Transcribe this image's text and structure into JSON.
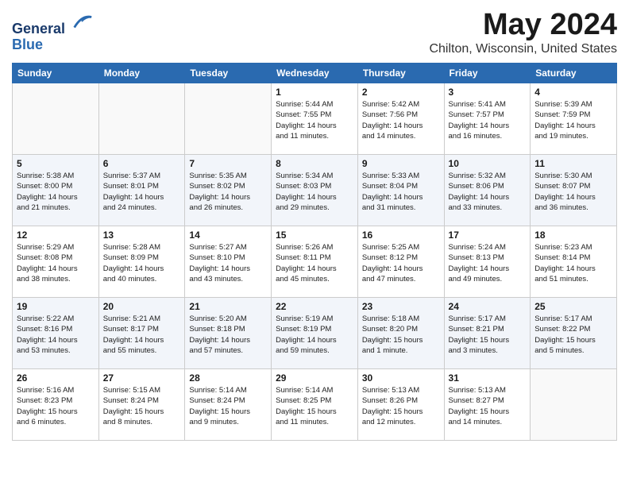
{
  "header": {
    "logo_line1": "General",
    "logo_line2": "Blue",
    "month_title": "May 2024",
    "location": "Chilton, Wisconsin, United States"
  },
  "days_of_week": [
    "Sunday",
    "Monday",
    "Tuesday",
    "Wednesday",
    "Thursday",
    "Friday",
    "Saturday"
  ],
  "weeks": [
    [
      {
        "day": "",
        "detail": ""
      },
      {
        "day": "",
        "detail": ""
      },
      {
        "day": "",
        "detail": ""
      },
      {
        "day": "1",
        "detail": "Sunrise: 5:44 AM\nSunset: 7:55 PM\nDaylight: 14 hours\nand 11 minutes."
      },
      {
        "day": "2",
        "detail": "Sunrise: 5:42 AM\nSunset: 7:56 PM\nDaylight: 14 hours\nand 14 minutes."
      },
      {
        "day": "3",
        "detail": "Sunrise: 5:41 AM\nSunset: 7:57 PM\nDaylight: 14 hours\nand 16 minutes."
      },
      {
        "day": "4",
        "detail": "Sunrise: 5:39 AM\nSunset: 7:59 PM\nDaylight: 14 hours\nand 19 minutes."
      }
    ],
    [
      {
        "day": "5",
        "detail": "Sunrise: 5:38 AM\nSunset: 8:00 PM\nDaylight: 14 hours\nand 21 minutes."
      },
      {
        "day": "6",
        "detail": "Sunrise: 5:37 AM\nSunset: 8:01 PM\nDaylight: 14 hours\nand 24 minutes."
      },
      {
        "day": "7",
        "detail": "Sunrise: 5:35 AM\nSunset: 8:02 PM\nDaylight: 14 hours\nand 26 minutes."
      },
      {
        "day": "8",
        "detail": "Sunrise: 5:34 AM\nSunset: 8:03 PM\nDaylight: 14 hours\nand 29 minutes."
      },
      {
        "day": "9",
        "detail": "Sunrise: 5:33 AM\nSunset: 8:04 PM\nDaylight: 14 hours\nand 31 minutes."
      },
      {
        "day": "10",
        "detail": "Sunrise: 5:32 AM\nSunset: 8:06 PM\nDaylight: 14 hours\nand 33 minutes."
      },
      {
        "day": "11",
        "detail": "Sunrise: 5:30 AM\nSunset: 8:07 PM\nDaylight: 14 hours\nand 36 minutes."
      }
    ],
    [
      {
        "day": "12",
        "detail": "Sunrise: 5:29 AM\nSunset: 8:08 PM\nDaylight: 14 hours\nand 38 minutes."
      },
      {
        "day": "13",
        "detail": "Sunrise: 5:28 AM\nSunset: 8:09 PM\nDaylight: 14 hours\nand 40 minutes."
      },
      {
        "day": "14",
        "detail": "Sunrise: 5:27 AM\nSunset: 8:10 PM\nDaylight: 14 hours\nand 43 minutes."
      },
      {
        "day": "15",
        "detail": "Sunrise: 5:26 AM\nSunset: 8:11 PM\nDaylight: 14 hours\nand 45 minutes."
      },
      {
        "day": "16",
        "detail": "Sunrise: 5:25 AM\nSunset: 8:12 PM\nDaylight: 14 hours\nand 47 minutes."
      },
      {
        "day": "17",
        "detail": "Sunrise: 5:24 AM\nSunset: 8:13 PM\nDaylight: 14 hours\nand 49 minutes."
      },
      {
        "day": "18",
        "detail": "Sunrise: 5:23 AM\nSunset: 8:14 PM\nDaylight: 14 hours\nand 51 minutes."
      }
    ],
    [
      {
        "day": "19",
        "detail": "Sunrise: 5:22 AM\nSunset: 8:16 PM\nDaylight: 14 hours\nand 53 minutes."
      },
      {
        "day": "20",
        "detail": "Sunrise: 5:21 AM\nSunset: 8:17 PM\nDaylight: 14 hours\nand 55 minutes."
      },
      {
        "day": "21",
        "detail": "Sunrise: 5:20 AM\nSunset: 8:18 PM\nDaylight: 14 hours\nand 57 minutes."
      },
      {
        "day": "22",
        "detail": "Sunrise: 5:19 AM\nSunset: 8:19 PM\nDaylight: 14 hours\nand 59 minutes."
      },
      {
        "day": "23",
        "detail": "Sunrise: 5:18 AM\nSunset: 8:20 PM\nDaylight: 15 hours\nand 1 minute."
      },
      {
        "day": "24",
        "detail": "Sunrise: 5:17 AM\nSunset: 8:21 PM\nDaylight: 15 hours\nand 3 minutes."
      },
      {
        "day": "25",
        "detail": "Sunrise: 5:17 AM\nSunset: 8:22 PM\nDaylight: 15 hours\nand 5 minutes."
      }
    ],
    [
      {
        "day": "26",
        "detail": "Sunrise: 5:16 AM\nSunset: 8:23 PM\nDaylight: 15 hours\nand 6 minutes."
      },
      {
        "day": "27",
        "detail": "Sunrise: 5:15 AM\nSunset: 8:24 PM\nDaylight: 15 hours\nand 8 minutes."
      },
      {
        "day": "28",
        "detail": "Sunrise: 5:14 AM\nSunset: 8:24 PM\nDaylight: 15 hours\nand 9 minutes."
      },
      {
        "day": "29",
        "detail": "Sunrise: 5:14 AM\nSunset: 8:25 PM\nDaylight: 15 hours\nand 11 minutes."
      },
      {
        "day": "30",
        "detail": "Sunrise: 5:13 AM\nSunset: 8:26 PM\nDaylight: 15 hours\nand 12 minutes."
      },
      {
        "day": "31",
        "detail": "Sunrise: 5:13 AM\nSunset: 8:27 PM\nDaylight: 15 hours\nand 14 minutes."
      },
      {
        "day": "",
        "detail": ""
      }
    ]
  ]
}
